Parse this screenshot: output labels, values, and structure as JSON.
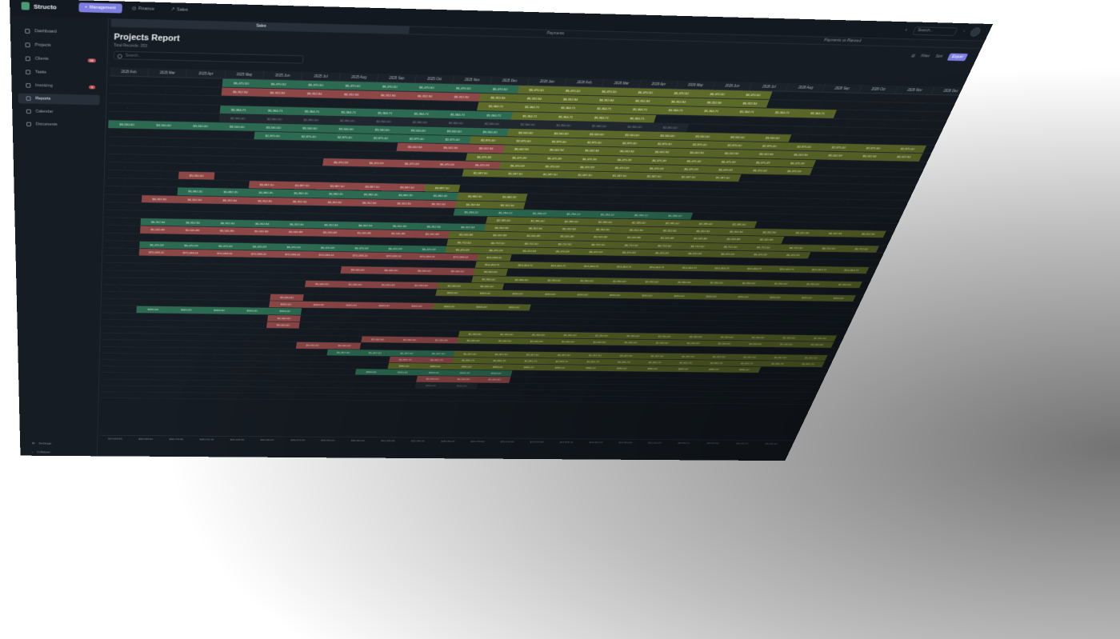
{
  "app": {
    "name": "Structo"
  },
  "nav": {
    "tabs": [
      {
        "label": "Management",
        "active": true
      },
      {
        "label": "Finance"
      },
      {
        "label": "Sales"
      }
    ]
  },
  "topbar": {
    "search_placeholder": "Search..."
  },
  "sidebar": {
    "items": [
      {
        "label": "Dashboard"
      },
      {
        "label": "Projects"
      },
      {
        "label": "Clients",
        "badge": "56"
      },
      {
        "label": "Tasks"
      },
      {
        "label": "Invoicing",
        "badge": "5"
      },
      {
        "label": "Reports",
        "active": true
      },
      {
        "label": "Calendar"
      },
      {
        "label": "Documents"
      }
    ],
    "settings_label": "Settings",
    "collapse_label": "Collapse"
  },
  "subtabs": [
    {
      "label": "Sales",
      "active": true
    },
    {
      "label": "Payments"
    },
    {
      "label": "Payments vs Planned"
    }
  ],
  "report": {
    "title": "Projects Report",
    "subtitle": "Total Records: 353",
    "search_placeholder": "Search...",
    "actions": {
      "filter": "Filter",
      "sort": "Sort",
      "export": "Export"
    }
  },
  "colors": {
    "positive": "#2c6b52",
    "negative": "#8e4747",
    "projected": "#5e6a2a",
    "background": "#161c23",
    "accent": "#7d7ee0"
  },
  "table": {
    "months": [
      "2025 Feb",
      "2025 Mar",
      "2025 Apr",
      "2025 May",
      "2025 Jun",
      "2025 Jul",
      "2025 Aug",
      "2025 Sep",
      "2025 Oct",
      "2025 Nov",
      "2025 Dec",
      "2026 Jan",
      "2026 Feb",
      "2026 Mar",
      "2026 Apr",
      "2026 May",
      "2026 Jun",
      "2026 Jul",
      "2026 Aug",
      "2026 Sep",
      "2026 Oct",
      "2026 Nov",
      "2026 Dec"
    ],
    "rows": [
      {
        "start": 3,
        "len": 15,
        "text": "$6,470.50",
        "kind": "g",
        "proj_from": 11
      },
      {
        "start": 3,
        "len": 15,
        "text": "$6,352.94",
        "kind": "r",
        "proj_from": 10
      },
      {
        "start": 10,
        "len": 10,
        "text": "$5,364.71",
        "kind": "y"
      },
      {
        "start": 3,
        "len": 12,
        "text": "$5,364.71",
        "kind": "g",
        "proj_from": 11
      },
      {
        "start": 3,
        "len": 13,
        "text": "$2,800.00",
        "kind": "d"
      },
      {
        "start": 0,
        "len": 19,
        "text": "$3,500.00",
        "kind": "g",
        "proj_from": 11
      },
      {
        "start": 4,
        "len": 19,
        "text": "$2,875.00",
        "kind": "g",
        "proj_from": 10
      },
      {
        "start": 8,
        "len": 15,
        "text": "$6,002.94",
        "kind": "r",
        "proj_from": 11
      },
      {
        "start": 10,
        "len": 10,
        "text": "$6,475.39",
        "kind": "y"
      },
      {
        "start": 6,
        "len": 14,
        "text": "$6,470.59",
        "kind": "r",
        "proj_from": 11
      },
      {
        "start": 10,
        "len": 8,
        "text": "$1,587.50",
        "kind": "y"
      },
      {
        "start": 2,
        "len": 1,
        "text": "$5,000.00",
        "kind": "r"
      },
      {
        "start": 4,
        "len": 6,
        "text": "$3,887.50",
        "kind": "r",
        "proj_from": 9
      },
      {
        "start": 2,
        "len": 10,
        "text": "$5,882.35",
        "kind": "g",
        "proj_from": 10
      },
      {
        "start": 1,
        "len": 11,
        "text": "$6,352.94",
        "kind": "r",
        "proj_from": 10
      },
      {
        "start": 10,
        "len": 7,
        "text": "$5,294.12",
        "kind": "g"
      },
      {
        "start": 11,
        "len": 8,
        "text": "$2,395.00",
        "kind": "y"
      },
      {
        "start": 1,
        "len": 22,
        "text": "$6,352.94",
        "kind": "g",
        "proj_from": 11
      },
      {
        "start": 1,
        "len": 19,
        "text": "$5,505.88",
        "kind": "r",
        "proj_from": 10
      },
      {
        "start": 10,
        "len": 13,
        "text": "$6,712.50",
        "kind": "y"
      },
      {
        "start": 1,
        "len": 20,
        "text": "$6,470.59",
        "kind": "g",
        "proj_from": 10
      },
      {
        "start": 1,
        "len": 11,
        "text": "$70,588.24",
        "kind": "r",
        "proj_from": 11
      },
      {
        "start": 11,
        "len": 12,
        "text": "$14,464.71",
        "kind": "y"
      },
      {
        "start": 7,
        "len": 5,
        "text": "$6,000.00",
        "kind": "r",
        "proj_from": 11
      },
      {
        "start": 11,
        "len": 12,
        "text": "$1,950.00",
        "kind": "y"
      },
      {
        "start": 6,
        "len": 6,
        "text": "$1,000.00",
        "kind": "r",
        "proj_from": 10
      },
      {
        "start": 10,
        "len": 13,
        "text": "$450.00",
        "kind": "y"
      },
      {
        "start": 5,
        "len": 1,
        "text": "$5,000.00",
        "kind": "r"
      },
      {
        "start": 5,
        "len": 8,
        "text": "$400.00",
        "kind": "r",
        "proj_from": 10
      },
      {
        "start": 1,
        "len": 5,
        "text": "$400.00",
        "kind": "g"
      },
      {
        "start": 5,
        "len": 1,
        "text": "$1,000.00",
        "kind": "r"
      },
      {
        "start": 5,
        "len": 1,
        "text": "$6,000.00",
        "kind": "r"
      },
      {
        "start": 11,
        "len": 12,
        "text": "$1,350.00",
        "kind": "y"
      },
      {
        "start": 8,
        "len": 15,
        "text": "$1,000.00",
        "kind": "r",
        "proj_from": 11
      },
      {
        "start": 6,
        "len": 2,
        "text": "$5,000.00",
        "kind": "r"
      },
      {
        "start": 7,
        "len": 16,
        "text": "$1,457.50",
        "kind": "g",
        "proj_from": 11
      },
      {
        "start": 9,
        "len": 14,
        "text": "$1,831.75",
        "kind": "r",
        "proj_from": 11
      },
      {
        "start": 9,
        "len": 12,
        "text": "$980.00",
        "kind": "y"
      },
      {
        "start": 8,
        "len": 5,
        "text": "$340.00",
        "kind": "g"
      },
      {
        "start": 10,
        "len": 3,
        "text": "$1,050.00",
        "kind": "r"
      },
      {
        "start": 10,
        "len": 2,
        "text": "$500.00",
        "kind": "d"
      },
      {
        "start": 10,
        "len": 1,
        "text": "",
        "kind": "d"
      },
      {
        "start": 0,
        "len": 0,
        "text": "",
        "kind": "d"
      }
    ],
    "totals": [
      "$41,505.94",
      "$69,546.94",
      "$56,276.36",
      "$49,076.18",
      "$55,528.36",
      "$62,082.47",
      "$45,673.39",
      "$30,090.00",
      "$40,360.40",
      "$41,435.36",
      "$42,395.31",
      "$38,185.23",
      "$31,726.84",
      "$31,016.35",
      "$22,876.80",
      "$19,876.11",
      "$16,820.77",
      "$13,985.88",
      "$10,212.00",
      "$8,920.71",
      "$7,512.52",
      "$6,234.75",
      "$5,240.00"
    ]
  }
}
